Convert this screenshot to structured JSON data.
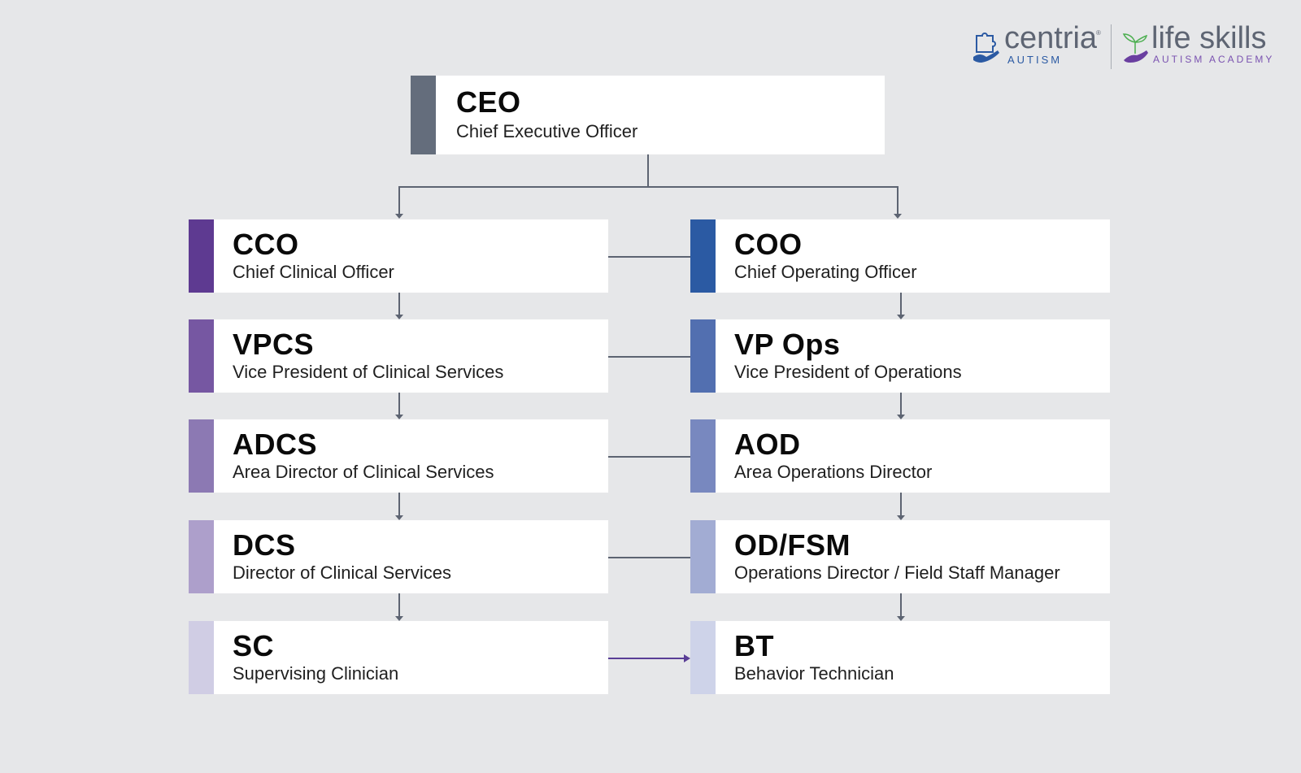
{
  "logos": {
    "centria": {
      "name": "centria",
      "sub": "AUTISM",
      "mark": "®"
    },
    "lifeskills": {
      "name": "life skills",
      "sub": "AUTISM ACADEMY"
    }
  },
  "colors": {
    "ceo": "#646d7c",
    "clinical": [
      "#5e3a91",
      "#7657a2",
      "#8c79b3",
      "#ad9fcb",
      "#d0cde4"
    ],
    "operations": [
      "#2b5aa3",
      "#526fb0",
      "#7888bf",
      "#a2acd3",
      "#ced3e9"
    ],
    "connector": "#5d6472",
    "highlight_arrow": "#5a3e96"
  },
  "ceo": {
    "abbr": "CEO",
    "title": "Chief Executive Officer"
  },
  "clinical_track": [
    {
      "abbr": "CCO",
      "title": "Chief Clinical Officer"
    },
    {
      "abbr": "VPCS",
      "title": "Vice President of Clinical Services"
    },
    {
      "abbr": "ADCS",
      "title": "Area Director of Clinical Services"
    },
    {
      "abbr": "DCS",
      "title": "Director of Clinical Services"
    },
    {
      "abbr": "SC",
      "title": "Supervising Clinician"
    }
  ],
  "operations_track": [
    {
      "abbr": "COO",
      "title": "Chief Operating Officer"
    },
    {
      "abbr": "VP Ops",
      "title": "Vice President of Operations"
    },
    {
      "abbr": "AOD",
      "title": "Area Operations Director"
    },
    {
      "abbr": "OD/FSM",
      "title": "Operations Director / Field Staff Manager"
    },
    {
      "abbr": "BT",
      "title": "Behavior Technician"
    }
  ]
}
